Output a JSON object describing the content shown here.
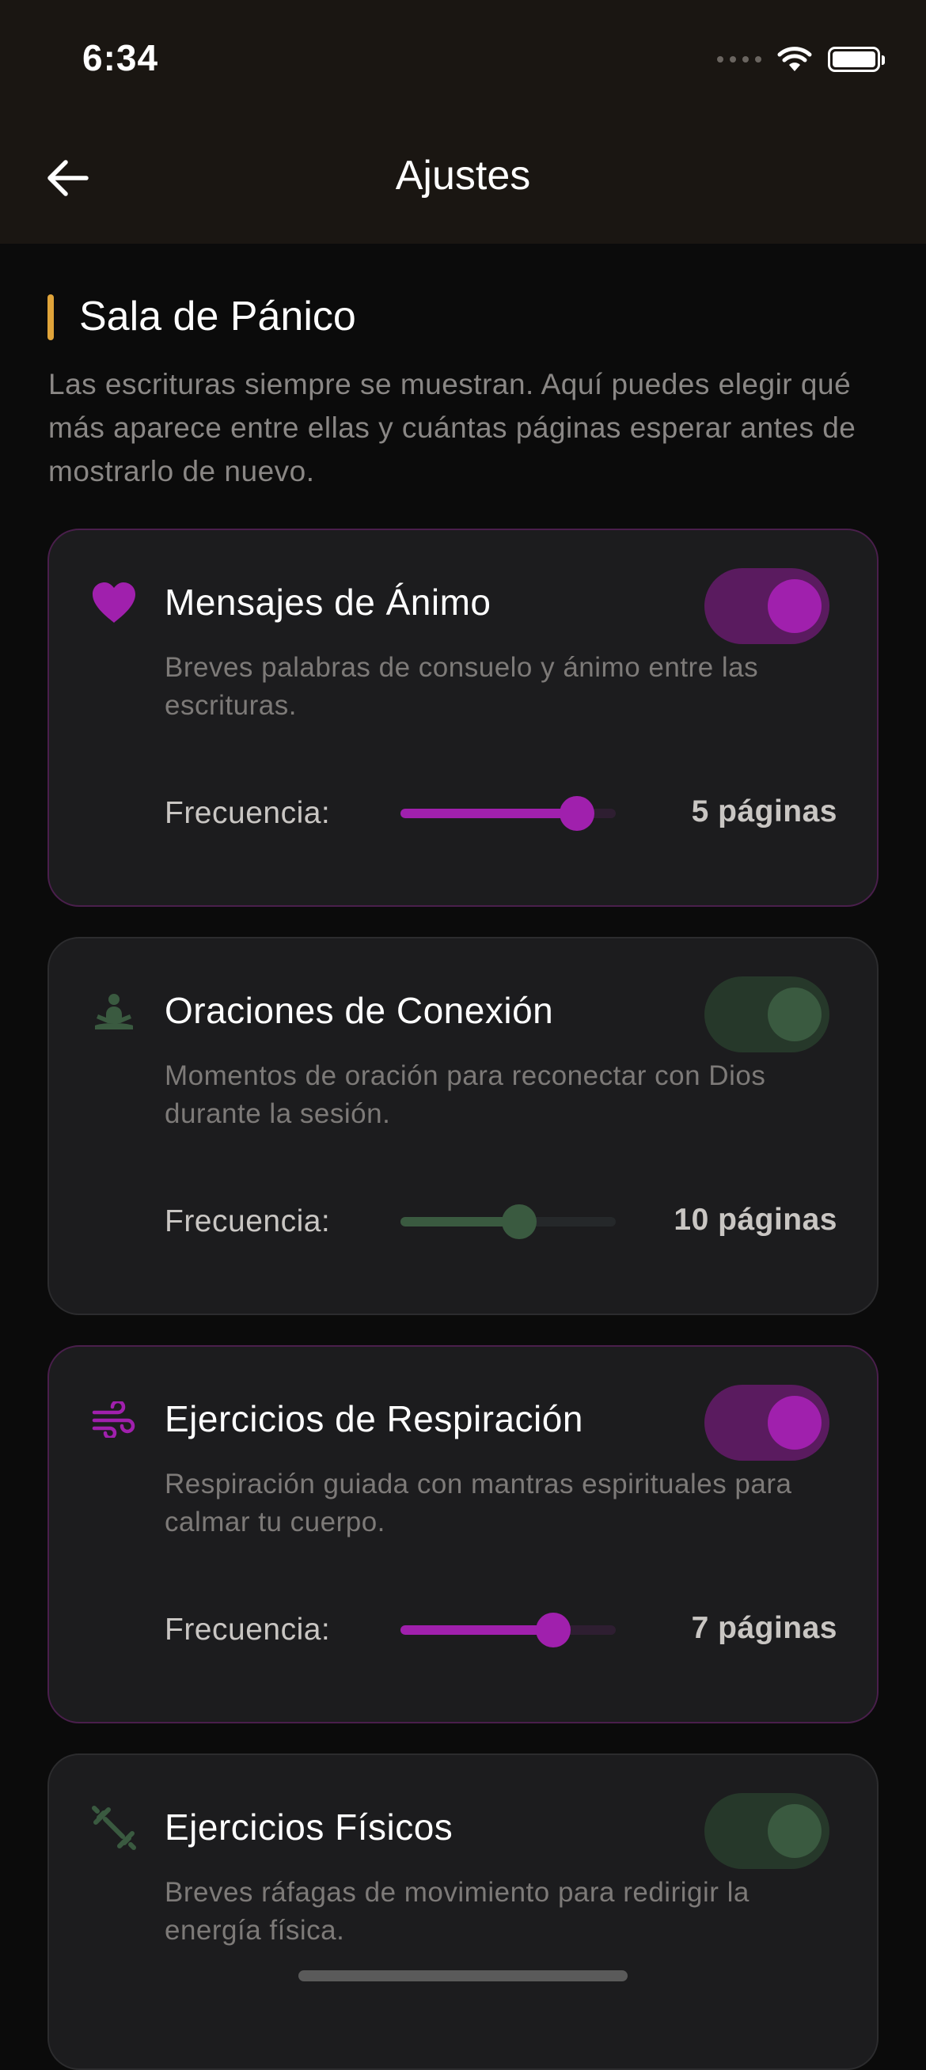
{
  "status_bar": {
    "time": "6:34"
  },
  "header": {
    "title": "Ajustes",
    "back_icon": "arrow-left-icon"
  },
  "section": {
    "title": "Sala de Pánico",
    "description": "Las escrituras siempre se muestran. Aquí puedes elegir qué más aparece entre ellas y cuántas páginas esperar antes de mostrarlo de nuevo.",
    "accent_color": "#e0a43a"
  },
  "colors": {
    "active_purple": "#a020ad",
    "inactive_green": "#3a5a40"
  },
  "cards": [
    {
      "title": "Mensajes de Ánimo",
      "description": "Breves palabras de consuelo y ánimo entre las escrituras.",
      "icon": "heart-icon",
      "enabled": true,
      "frequency_label": "Frecuencia:",
      "frequency_value": "5 páginas",
      "slider_fraction": 0.82
    },
    {
      "title": "Oraciones de Conexión",
      "description": "Momentos de oración para reconectar con Dios durante la sesión.",
      "icon": "meditation-icon",
      "enabled": false,
      "frequency_label": "Frecuencia:",
      "frequency_value": "10 páginas",
      "slider_fraction": 0.55
    },
    {
      "title": "Ejercicios de Respiración",
      "description": "Respiración guiada con mantras espirituales para calmar tu cuerpo.",
      "icon": "wind-icon",
      "enabled": true,
      "frequency_label": "Frecuencia:",
      "frequency_value": "7 páginas",
      "slider_fraction": 0.71
    },
    {
      "title": "Ejercicios Físicos",
      "description": "Breves ráfagas de movimiento para redirigir la energía física.",
      "icon": "dumbbell-icon",
      "enabled": false
    }
  ]
}
